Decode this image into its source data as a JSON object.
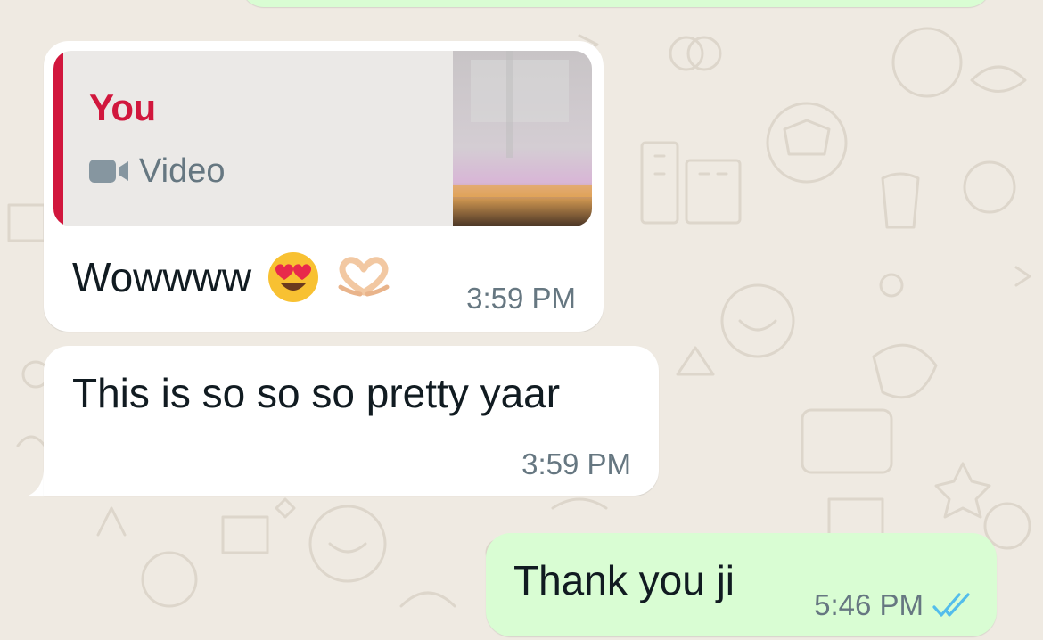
{
  "chat": {
    "messages": [
      {
        "direction": "incoming",
        "reply_to": {
          "author": "You",
          "media_type": "Video",
          "media_icon": "video-camera-icon"
        },
        "text": "Wowwww",
        "emojis": [
          "heart-eyes-emoji",
          "heart-hands-emoji"
        ],
        "time": "3:59 PM"
      },
      {
        "direction": "incoming",
        "text": "This is so so so pretty yaar",
        "time": "3:59 PM"
      },
      {
        "direction": "outgoing",
        "text": "Thank you ji",
        "time": "5:46 PM",
        "status": "read",
        "status_icon": "double-check-icon"
      }
    ]
  },
  "colors": {
    "wallpaper": "#efeae2",
    "incoming_bubble": "#ffffff",
    "outgoing_bubble": "#d9fdd3",
    "quote_accent": "#d1173d",
    "read_ticks": "#53bdeb",
    "meta_text": "#667781"
  }
}
